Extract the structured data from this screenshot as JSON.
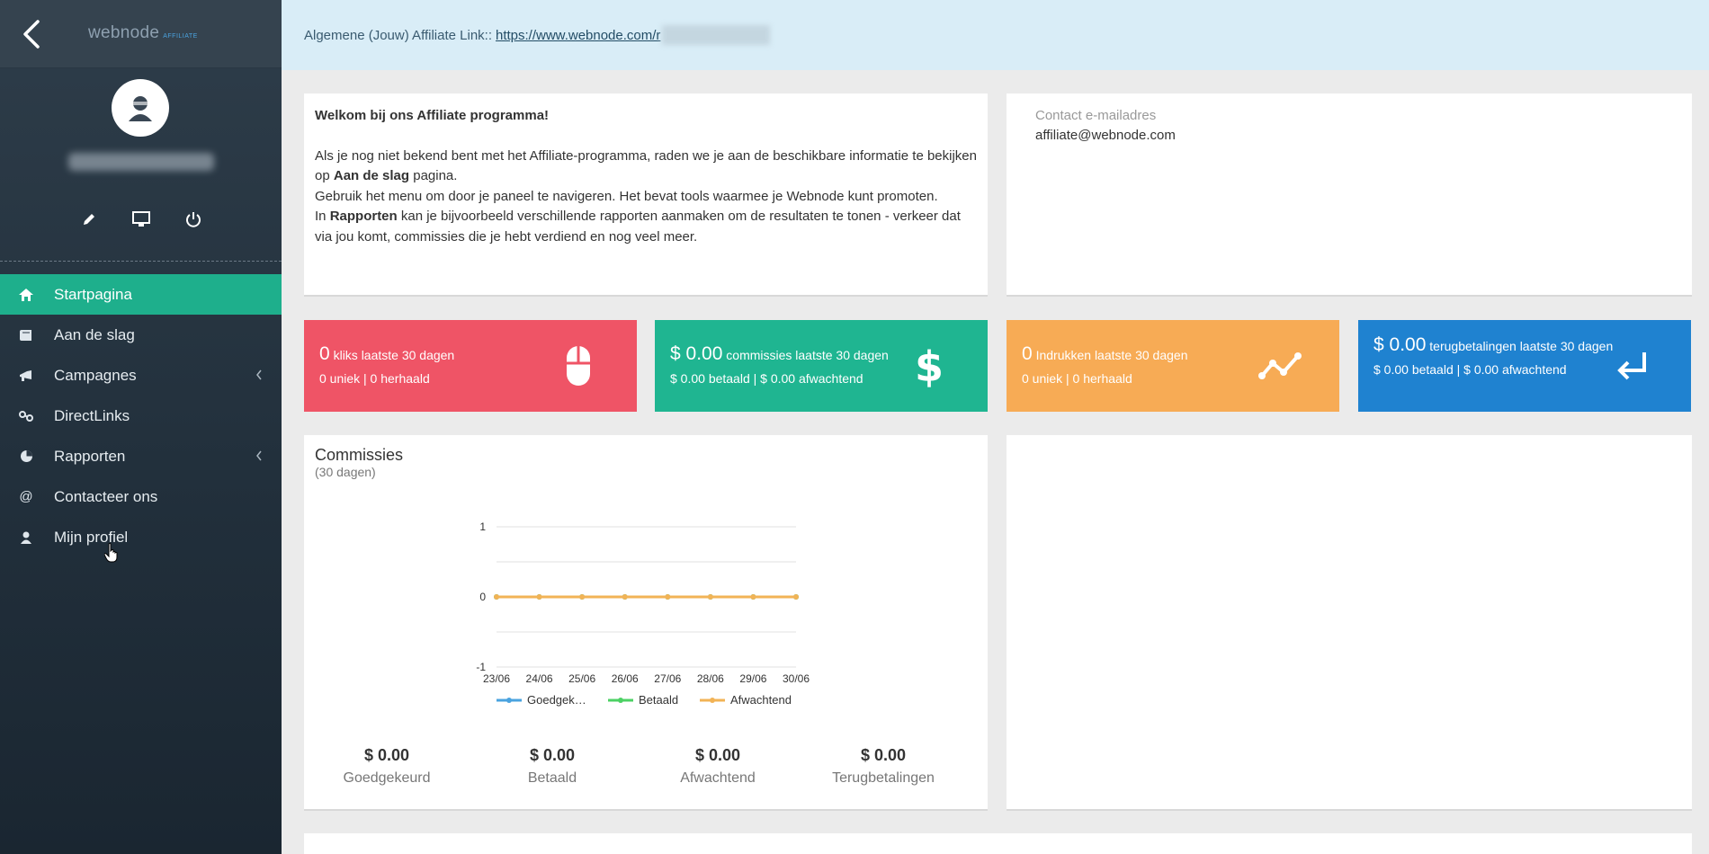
{
  "sidebar": {
    "logo": "webnode",
    "logo_sub": "AFFILIATE",
    "nav": [
      {
        "label": "Startpagina",
        "icon": "home-icon",
        "active": true
      },
      {
        "label": "Aan de slag",
        "icon": "book-icon"
      },
      {
        "label": "Campagnes",
        "icon": "bullhorn-icon",
        "submenu": true
      },
      {
        "label": "DirectLinks",
        "icon": "link-icon"
      },
      {
        "label": "Rapporten",
        "icon": "pie-chart-icon",
        "submenu": true
      },
      {
        "label": "Contacteer ons",
        "icon": "at-icon"
      },
      {
        "label": "Mijn profiel",
        "icon": "user-icon"
      }
    ]
  },
  "topbar": {
    "label": "Algemene (Jouw) Affiliate Link::",
    "link": "https://www.webnode.com/r"
  },
  "welcome": {
    "title": "Welkom bij ons Affiliate programma!",
    "p1": "Als je nog niet bekend bent met het Affiliate-programma, raden we je aan de beschikbare informatie te bekijken",
    "p2_pre": "op ",
    "p2_bold": "Aan de slag",
    "p2_post": " pagina.",
    "p3": "Gebruik het menu om door je paneel te navigeren. Het bevat tools waarmee je Webnode kunt promoten.",
    "p4_pre": "In ",
    "p4_bold": "Rapporten",
    "p4_post": " kan je bijvoorbeeld verschillende rapporten aanmaken om de resultaten te tonen - verkeer dat via jou komt, commissies die je hebt verdiend en nog veel meer."
  },
  "contact": {
    "label": "Contact e-mailadres",
    "email": "affiliate@webnode.com"
  },
  "stats": [
    {
      "big": "0",
      "title": "kliks laatste 30 dagen",
      "sub": "0 uniek | 0 herhaald",
      "color": "#ef5466",
      "icon": "mouse-icon"
    },
    {
      "big": "$ 0.00",
      "title": "commissies laatste 30 dagen",
      "sub": "$ 0.00 betaald | $ 0.00 afwachtend",
      "color": "#1fb591",
      "icon": "dollar-icon"
    },
    {
      "big": "0",
      "title": "Indrukken laatste 30 dagen",
      "sub": "0 uniek | 0 herhaald",
      "color": "#f7ab55",
      "icon": "trend-line-icon"
    },
    {
      "big": "$ 0.00",
      "title": "terugbetalingen laatste 30 dagen",
      "sub": "$ 0.00 betaald | $ 0.00 afwachtend",
      "color": "#1f82d0",
      "icon": "return-arrow-icon"
    }
  ],
  "commissions": {
    "title": "Commissies",
    "subtitle": "(30 dagen)",
    "totals": [
      {
        "amount": "$ 0.00",
        "label": "Goedgekeurd"
      },
      {
        "amount": "$ 0.00",
        "label": "Betaald"
      },
      {
        "amount": "$ 0.00",
        "label": "Afwachtend"
      },
      {
        "amount": "$ 0.00",
        "label": "Terugbetalingen"
      }
    ]
  },
  "chart_data": {
    "type": "line",
    "x": [
      "23/06",
      "24/06",
      "25/06",
      "26/06",
      "27/06",
      "28/06",
      "29/06",
      "30/06"
    ],
    "ylim": [
      -1,
      1
    ],
    "yticks": [
      1,
      0,
      -1
    ],
    "grid": true,
    "legend": "bottom",
    "series": [
      {
        "name": "Goedgek…",
        "values": [
          0,
          0,
          0,
          0,
          0,
          0,
          0,
          0
        ],
        "color": "#4aa3df"
      },
      {
        "name": "Betaald",
        "values": [
          0,
          0,
          0,
          0,
          0,
          0,
          0,
          0
        ],
        "color": "#4cd164"
      },
      {
        "name": "Afwachtend",
        "values": [
          0,
          0,
          0,
          0,
          0,
          0,
          0,
          0
        ],
        "color": "#f2b356"
      }
    ]
  }
}
